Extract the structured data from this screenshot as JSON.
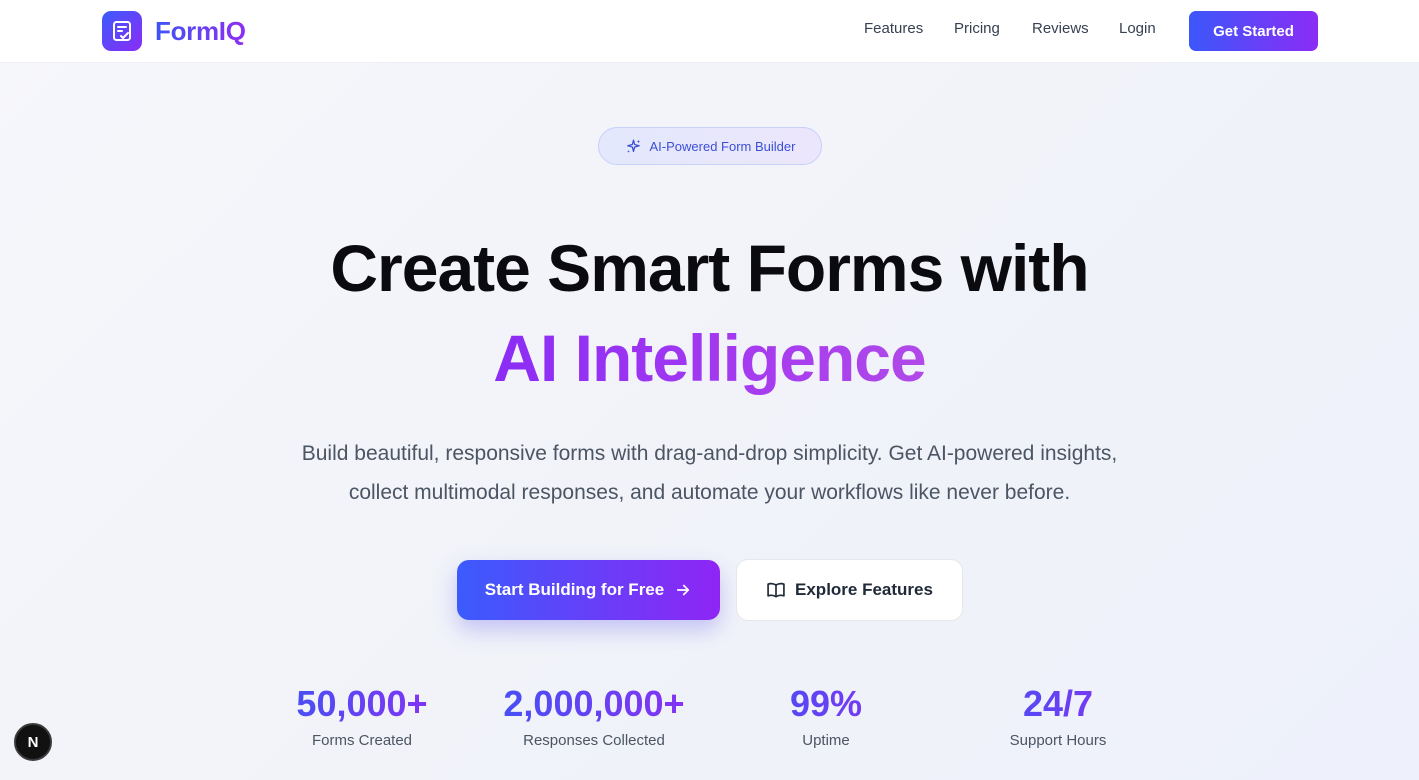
{
  "brand": {
    "name": "FormIQ"
  },
  "nav": {
    "links": [
      "Features",
      "Pricing",
      "Reviews",
      "Login"
    ],
    "cta": "Get Started"
  },
  "hero": {
    "badge": "AI-Powered Form Builder",
    "title_line1": "Create Smart Forms with",
    "title_line2": "AI Intelligence",
    "subtitle_line1": "Build beautiful, responsive forms with drag-and-drop simplicity. Get AI-powered insights,",
    "subtitle_line2": "collect multimodal responses, and automate your workflows like never before.",
    "primary_button": "Start Building for Free",
    "secondary_button": "Explore Features"
  },
  "stats": [
    {
      "value": "50,000+",
      "label": "Forms Created"
    },
    {
      "value": "2,000,000+",
      "label": "Responses Collected"
    },
    {
      "value": "99%",
      "label": "Uptime"
    },
    {
      "value": "24/7",
      "label": "Support Hours"
    }
  ],
  "dev_badge": "N",
  "colors": {
    "accent_blue": "#3b5bfd",
    "accent_purple": "#8b2cf5",
    "badge_text": "#3b4fd6",
    "headline": "#0b0b0f",
    "body_text": "#4b5563"
  },
  "icons": {
    "logo": "form-check-icon",
    "badge": "sparkles-icon",
    "primary_button": "arrow-right-icon",
    "secondary_button": "book-open-icon"
  }
}
